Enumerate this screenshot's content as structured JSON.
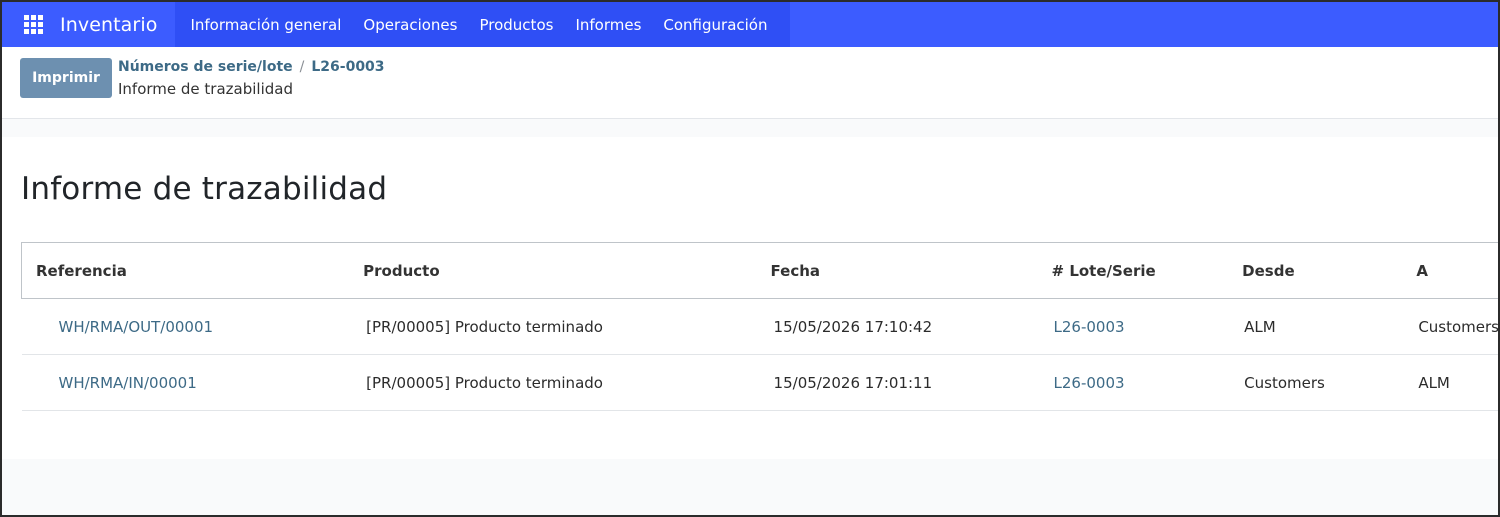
{
  "navbar": {
    "app_name": "Inventario",
    "menu": [
      {
        "label": "Información general"
      },
      {
        "label": "Operaciones"
      },
      {
        "label": "Productos"
      },
      {
        "label": "Informes"
      },
      {
        "label": "Configuración"
      }
    ],
    "apps_icon": "grid-apps-icon",
    "color": "#3c5cff"
  },
  "control": {
    "print_label": "Imprimir",
    "breadcrumb": {
      "parent": "Números de serie/lote",
      "separator": "/",
      "current": "L26-0003"
    },
    "subtitle": "Informe de trazabilidad"
  },
  "report": {
    "title": "Informe de trazabilidad",
    "columns": [
      "Referencia",
      "Producto",
      "Fecha",
      "# Lote/Serie",
      "Desde",
      "A"
    ],
    "rows": [
      {
        "reference": "WH/RMA/OUT/00001",
        "product": "[PR/00005] Producto terminado",
        "date": "15/05/2026 17:10:42",
        "lot": "L26-0003",
        "from": "ALM",
        "to": "Customers"
      },
      {
        "reference": "WH/RMA/IN/00001",
        "product": "[PR/00005] Producto terminado",
        "date": "15/05/2026 17:01:11",
        "lot": "L26-0003",
        "from": "Customers",
        "to": "ALM"
      }
    ]
  }
}
